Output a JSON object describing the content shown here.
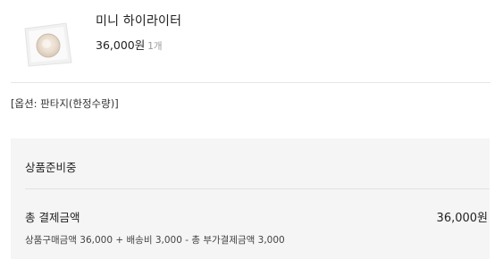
{
  "product": {
    "name": "미니 하이라이터",
    "price": "36,000원",
    "quantity": "1개",
    "image_icon": "compact-highlighter-icon"
  },
  "option": {
    "text": "[옵션: 판타지(한정수량)]"
  },
  "summary": {
    "status": "상품준비중",
    "total_label": "총 결제금액",
    "total_value": "36,000원",
    "breakdown": "상품구매금액 36,000 + 배송비 3,000 - 총 부가결제금액 3,000"
  }
}
